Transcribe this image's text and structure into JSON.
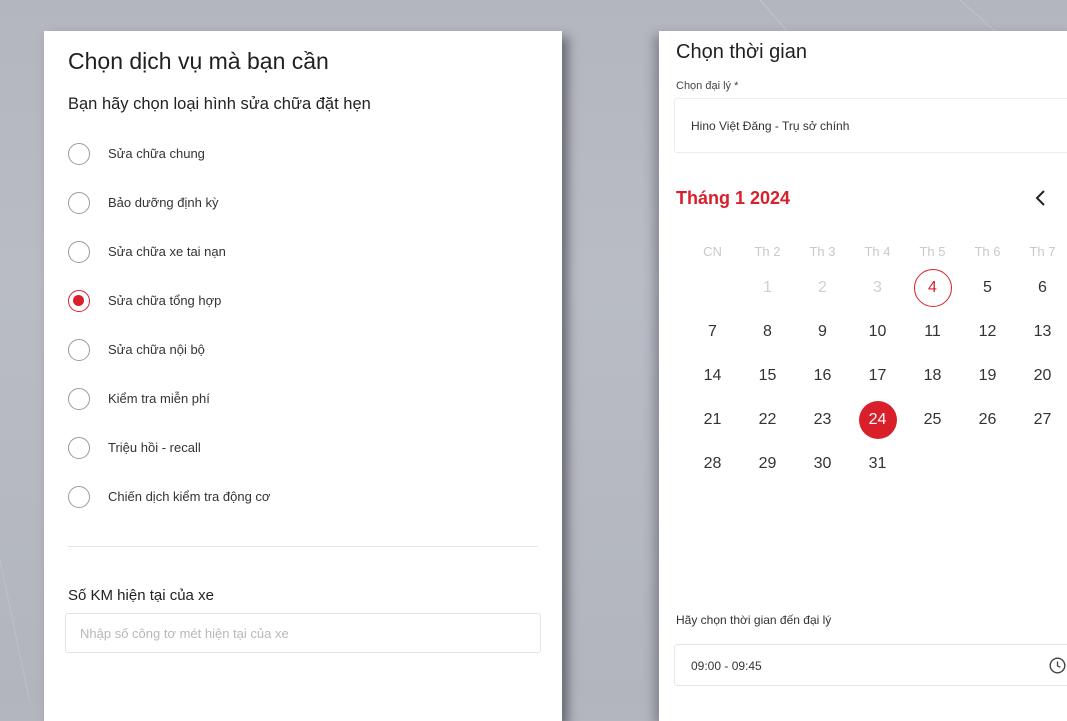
{
  "service_panel": {
    "title": "Chọn dịch vụ mà bạn cần",
    "subtitle": "Bạn hãy chọn loại hình sửa chữa đặt hẹn",
    "options": [
      {
        "label": "Sửa chữa chung",
        "checked": false
      },
      {
        "label": "Bảo dưỡng định kỳ",
        "checked": false
      },
      {
        "label": "Sửa chữa xe tai nạn",
        "checked": false
      },
      {
        "label": "Sửa chữa tổng hợp",
        "checked": true
      },
      {
        "label": "Sửa chữa nội bộ",
        "checked": false
      },
      {
        "label": "Kiểm tra miễn phí",
        "checked": false
      },
      {
        "label": "Triệu hồi - recall",
        "checked": false
      },
      {
        "label": "Chiến dịch kiểm tra động cơ",
        "checked": false
      }
    ],
    "km_label": "Số KM hiện tại của xe",
    "km_placeholder": "Nhập số công tơ mét hiện tại của xe",
    "km_value": ""
  },
  "time_panel": {
    "title": "Chọn thời gian",
    "dealer_label": "Chọn đại lý *",
    "dealer_value": "Hino Việt Đăng - Trụ sở chính",
    "month_title": "Tháng 1 2024",
    "weekday_headers": [
      "CN",
      "Th 2",
      "Th 3",
      "Th 4",
      "Th 5",
      "Th 6",
      "Th 7"
    ],
    "calendar_weeks": [
      [
        "",
        "1",
        "2",
        "3",
        "4",
        "5",
        "6"
      ],
      [
        "7",
        "8",
        "9",
        "10",
        "11",
        "12",
        "13"
      ],
      [
        "14",
        "15",
        "16",
        "17",
        "18",
        "19",
        "20"
      ],
      [
        "21",
        "22",
        "23",
        "24",
        "25",
        "26",
        "27"
      ],
      [
        "28",
        "29",
        "30",
        "31",
        "",
        "",
        ""
      ]
    ],
    "today_day": "4",
    "selected_day": "24",
    "disabled_days": [
      "1",
      "2",
      "3"
    ],
    "time_label": "Hãy chọn thời gian đến đại lý",
    "time_value": "09:00 - 09:45",
    "icons": {
      "dealer_dropdown": "chevron-down-icon",
      "prev_month": "chevron-left-icon",
      "time_picker": "clock-icon"
    }
  },
  "colors": {
    "accent": "#d9202a",
    "background": "#b7bac3",
    "muted_text": "#cfcfcf"
  }
}
